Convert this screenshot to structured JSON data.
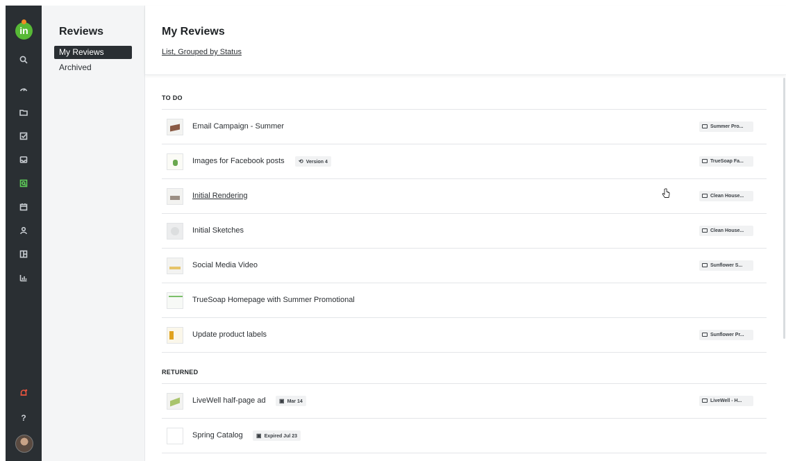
{
  "rail": {
    "icons": [
      "search-icon",
      "gauge-icon",
      "folder-icon",
      "task-check-icon",
      "inbox-icon",
      "reviews-icon",
      "calendar-icon",
      "user-icon",
      "layout-icon",
      "reports-icon",
      "notifications-icon"
    ],
    "help_label": "?",
    "logo_text": "in"
  },
  "subnav": {
    "title": "Reviews",
    "items": [
      {
        "label": "My Reviews"
      },
      {
        "label": "Archived"
      }
    ]
  },
  "header": {
    "title": "My Reviews",
    "view_link": "List, Grouped by Status"
  },
  "sections": [
    {
      "label": "TO DO",
      "rows": [
        {
          "name": "Email Campaign - Summer",
          "folder": "Summer Pro..."
        },
        {
          "name": "Images for Facebook posts",
          "chip": "Version 4",
          "folder": "TrueSoap Fa..."
        },
        {
          "name": "Initial Rendering",
          "folder": "Clean House..."
        },
        {
          "name": "Initial Sketches",
          "folder": "Clean House..."
        },
        {
          "name": "Social Media Video",
          "folder": "Sunflower S..."
        },
        {
          "name": "TrueSoap Homepage with Summer Promotional"
        },
        {
          "name": "Update product labels",
          "folder": "Sunflower Pr..."
        }
      ]
    },
    {
      "label": "RETURNED",
      "rows": [
        {
          "name": "LiveWell half-page ad",
          "chip": "Mar 14",
          "folder": "LiveWell - H..."
        },
        {
          "name": "Spring Catalog",
          "chip": "Expired Jul 23"
        }
      ]
    }
  ],
  "colors": {
    "rail": "#2a2f33",
    "accent": "#5fd05a",
    "logo": "#57b936",
    "alert": "#e8553f"
  }
}
